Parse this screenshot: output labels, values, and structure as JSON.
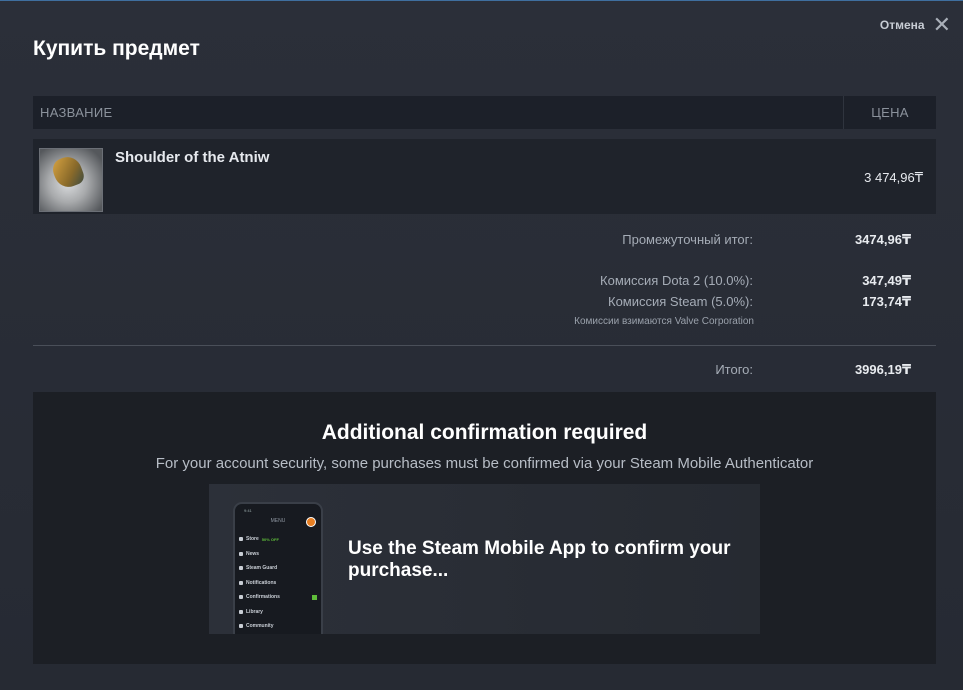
{
  "dialog": {
    "title": "Купить предмет",
    "cancel_label": "Отмена",
    "cancel_icon": "close-icon"
  },
  "table": {
    "col_name": "НАЗВАНИЕ",
    "col_price": "ЦЕНА"
  },
  "item": {
    "name": "Shoulder of the Atniw",
    "price": "3 474,96₸",
    "thumbnail": "item-thumbnail"
  },
  "summary": {
    "subtotal_label": "Промежуточный итог:",
    "subtotal_value": "3474,96₸",
    "fee_game_label": "Комиссия Dota 2 (10.0%):",
    "fee_game_value": "347,49₸",
    "fee_steam_label": "Комиссия Steam (5.0%):",
    "fee_steam_value": "173,74₸",
    "fee_note": "Комиссии взимаются Valve Corporation",
    "total_label": "Итого:",
    "total_value": "3996,19₸"
  },
  "confirmation": {
    "title": "Additional confirmation required",
    "subtitle": "For your account security, some purchases must be confirmed via your Steam Mobile Authenticator",
    "banner_text": "Use the Steam Mobile App to confirm your purchase...",
    "phone": {
      "time": "9:41",
      "menu_label": "MENU",
      "items": [
        {
          "label": "Store",
          "tag": "50% OFF"
        },
        {
          "label": "News",
          "tag": ""
        },
        {
          "label": "Steam Guard",
          "tag": ""
        },
        {
          "label": "Notifications",
          "tag": ""
        },
        {
          "label": "Confirmations",
          "tag": ""
        },
        {
          "label": "Library",
          "tag": ""
        },
        {
          "label": "Community",
          "tag": ""
        }
      ]
    }
  },
  "colors": {
    "background": "#2b2f39",
    "panel": "#1c1f25",
    "accent_green": "#5fbd3a"
  }
}
